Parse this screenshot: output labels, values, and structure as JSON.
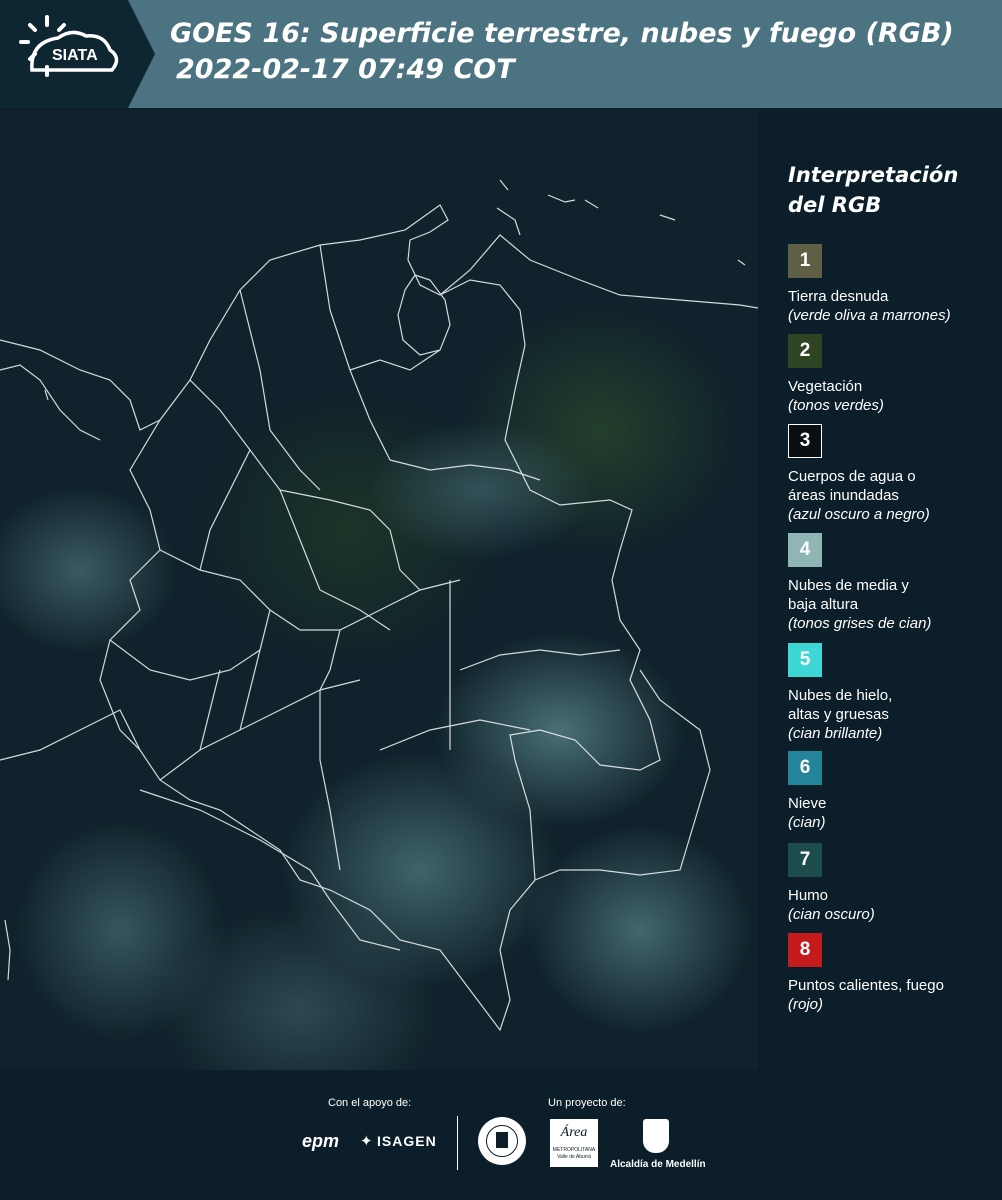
{
  "header": {
    "logo_text": "SIATA",
    "title_line1": "GOES 16: Superficie terrestre, nubes y fuego (RGB)",
    "title_line2": "2022-02-17 07:49 COT"
  },
  "legend": {
    "title_line1": "Interpretación",
    "title_line2": "del RGB",
    "items": [
      {
        "number": "1",
        "color": "#5f5f45",
        "name": "Tierra desnuda",
        "desc": "(verde oliva a marrones)"
      },
      {
        "number": "2",
        "color": "#2e4423",
        "name": "Vegetación",
        "desc": "(tonos verdes)"
      },
      {
        "number": "3",
        "color": "#0b0f12",
        "name": "Cuerpos de agua o áreas inundadas",
        "desc": "(azul oscuro a negro)"
      },
      {
        "number": "4",
        "color": "#8fb5b4",
        "name": "Nubes de media y baja altura",
        "desc": "(tonos grises de cian)"
      },
      {
        "number": "5",
        "color": "#3fd6d6",
        "name": "Nubes de hielo, altas y gruesas",
        "desc": "(cian brillante)"
      },
      {
        "number": "6",
        "color": "#24849a",
        "name": "Nieve",
        "desc": "(cian)"
      },
      {
        "number": "7",
        "color": "#1c4c4c",
        "name": "Humo",
        "desc": "(cian oscuro)"
      },
      {
        "number": "8",
        "color": "#c41c1c",
        "name": "Puntos calientes, fuego",
        "desc": "(rojo)"
      }
    ]
  },
  "footer": {
    "support_label": "Con el apoyo de:",
    "project_label": "Un proyecto de:",
    "epm": "epm",
    "isagen": "ISAGEN",
    "area_name": "Área",
    "area_sub1": "METROPOLITANA",
    "area_sub2": "Valle de Aburrá",
    "alcaldia": "Alcaldía de Medellín"
  },
  "colors": {
    "header_bg": "#4c7382",
    "logo_bg": "#0e2532",
    "page_bg": "#0c1e29"
  }
}
